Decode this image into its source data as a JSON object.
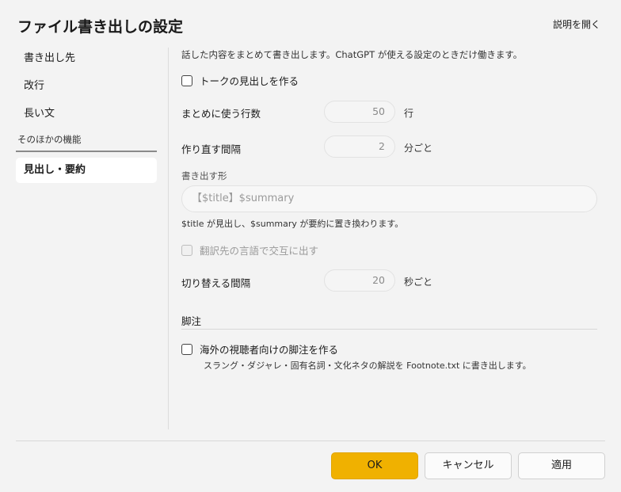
{
  "dialog": {
    "title": "ファイル書き出しの設定",
    "help_link": "説明を開く"
  },
  "sidebar": {
    "items": [
      {
        "label": "書き出し先"
      },
      {
        "label": "改行"
      },
      {
        "label": "長い文"
      }
    ],
    "section_header": "そのほかの機能",
    "selected_item": {
      "label": "見出し・要約"
    }
  },
  "main": {
    "description": "話した内容をまとめて書き出します。ChatGPT が使える設定のときだけ働きます。",
    "talk_heading_checkbox": {
      "label": "トークの見出しを作る",
      "checked": false
    },
    "summary_lines": {
      "label": "まとめに使う行数",
      "value": "50",
      "unit": "行"
    },
    "regen_interval": {
      "label": "作り直す間隔",
      "value": "2",
      "unit": "分ごと"
    },
    "output_format": {
      "label": "書き出す形",
      "placeholder": "【$title】$summary"
    },
    "format_hint": "$title が見出し、$summary が要約に置き換わります。",
    "alternate_checkbox": {
      "label": "翻訳先の言語で交互に出す",
      "checked": false,
      "disabled": true
    },
    "switch_interval": {
      "label": "切り替える間隔",
      "value": "20",
      "unit": "秒ごと"
    },
    "footnote_section": {
      "title": "脚注",
      "checkbox": {
        "label": "海外の視聴者向けの脚注を作る",
        "checked": false
      },
      "hint": "スラング・ダジャレ・固有名詞・文化ネタの解説を Footnote.txt に書き出します。"
    }
  },
  "footer": {
    "ok": "OK",
    "cancel": "キャンセル",
    "apply": "適用"
  },
  "colors": {
    "accent": "#f0b100",
    "background": "#f3f3f3",
    "selected_nav": "#ffffff"
  }
}
